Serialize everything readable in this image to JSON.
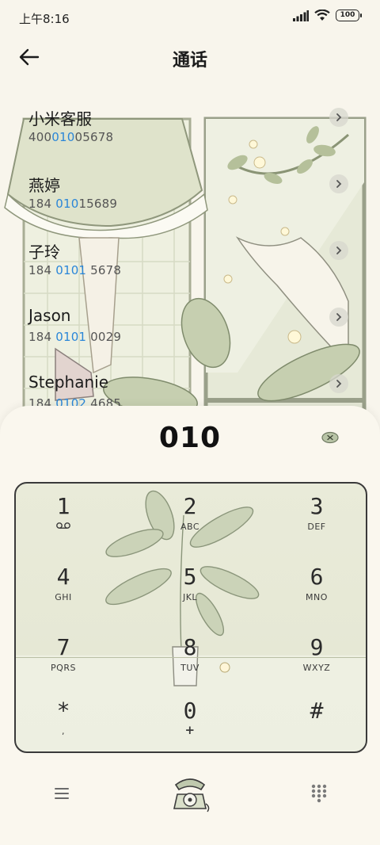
{
  "status_bar": {
    "time": "上午8:16",
    "battery": "100"
  },
  "header": {
    "title": "通话"
  },
  "contacts": [
    {
      "name": "小米客服",
      "number_pre": "400",
      "number_hl": "010",
      "number_post": "05678"
    },
    {
      "name": "燕婷",
      "number_pre": "184 ",
      "number_hl": "010",
      "number_post": "15689"
    },
    {
      "name": "子玲",
      "number_pre": "184 ",
      "number_hl": "0101",
      "number_post": " 5678"
    },
    {
      "name": "Jason",
      "number_pre": "184 ",
      "number_hl": "0101",
      "number_post": " 0029"
    },
    {
      "name": "Stephanie",
      "number_pre": "184 ",
      "number_hl": "0102",
      "number_post": " 4685"
    }
  ],
  "dialer": {
    "input": "010"
  },
  "keys": [
    {
      "digit": "1",
      "letters": ""
    },
    {
      "digit": "2",
      "letters": "ABC"
    },
    {
      "digit": "3",
      "letters": "DEF"
    },
    {
      "digit": "4",
      "letters": "GHI"
    },
    {
      "digit": "5",
      "letters": "JKL"
    },
    {
      "digit": "6",
      "letters": "MNO"
    },
    {
      "digit": "7",
      "letters": "PQRS"
    },
    {
      "digit": "8",
      "letters": "TUV"
    },
    {
      "digit": "9",
      "letters": "WXYZ"
    },
    {
      "digit": "*",
      "letters": ","
    },
    {
      "digit": "0",
      "letters": "+"
    },
    {
      "digit": "#",
      "letters": ""
    }
  ],
  "icons": {
    "back": "arrow-left-icon",
    "detail": "chevron-right-icon",
    "delete": "backspace-icon",
    "voicemail": "voicemail-icon",
    "menu": "hamburger-menu-icon",
    "call": "rotary-phone-icon",
    "keypad": "dialpad-icon"
  },
  "colors": {
    "highlight": "#2a86d8",
    "background": "#f8f5ec",
    "keypad": "#e8ead7"
  }
}
